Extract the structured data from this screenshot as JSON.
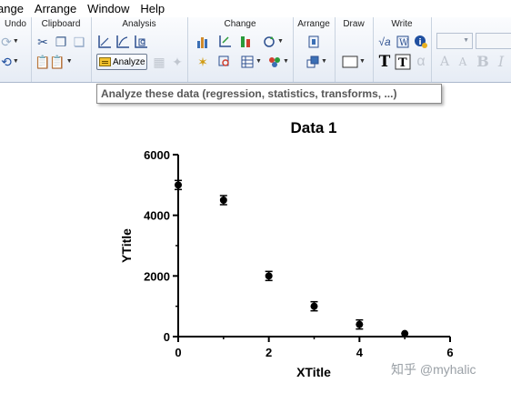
{
  "menubar": {
    "items": [
      "ange",
      "Arrange",
      "Window",
      "Help"
    ]
  },
  "ribbon": {
    "groups": {
      "undo": "Undo",
      "clipboard": "Clipboard",
      "analysis": "Analysis",
      "change": "Change",
      "arrange": "Arrange",
      "draw": "Draw",
      "write": "Write"
    },
    "analyze_label": "Analyze"
  },
  "tooltip": {
    "text": "Analyze these data (regression, statistics, transforms, ...)"
  },
  "chart_data": {
    "type": "scatter",
    "title": "Data 1",
    "xlabel": "XTitle",
    "ylabel": "YTitle",
    "xlim": [
      0,
      6
    ],
    "ylim": [
      0,
      6000
    ],
    "xticks": [
      0,
      2,
      4,
      6
    ],
    "yticks": [
      0,
      2000,
      4000,
      6000
    ],
    "grid": false,
    "points": [
      {
        "x": 0,
        "y": 5000,
        "err": 150
      },
      {
        "x": 1,
        "y": 4500,
        "err": 150
      },
      {
        "x": 2,
        "y": 2000,
        "err": 150
      },
      {
        "x": 3,
        "y": 1000,
        "err": 150
      },
      {
        "x": 4,
        "y": 400,
        "err": 150
      },
      {
        "x": 5,
        "y": 100,
        "err": 0
      }
    ],
    "marker_color": "#000000"
  },
  "watermark": "知乎 @myhalic"
}
